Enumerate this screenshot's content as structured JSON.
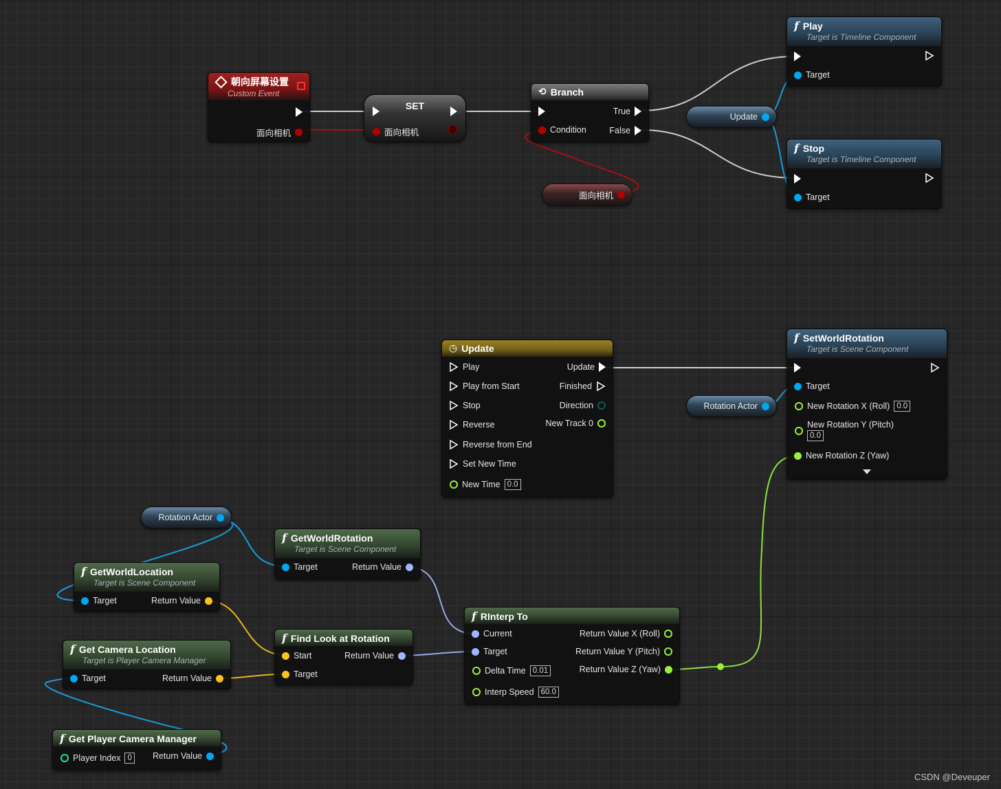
{
  "nodes": {
    "custom_event": {
      "title": "朝向屏幕设置",
      "subtitle": "Custom Event",
      "out_pin": "面向相机"
    },
    "set": {
      "title": "SET",
      "in_pin": "面向相机"
    },
    "branch": {
      "title": "Branch",
      "condition": "Condition",
      "true_label": "True",
      "false_label": "False"
    },
    "var_facing": {
      "label": "面向相机"
    },
    "var_update": {
      "label": "Update"
    },
    "play": {
      "title": "Play",
      "subtitle": "Target is Timeline Component",
      "target": "Target"
    },
    "stop": {
      "title": "Stop",
      "subtitle": "Target is Timeline Component",
      "target": "Target"
    },
    "timeline": {
      "title": "Update",
      "inputs": [
        "Play",
        "Play from Start",
        "Stop",
        "Reverse",
        "Reverse from End",
        "Set New Time"
      ],
      "new_time_label": "New Time",
      "new_time_value": "0.0",
      "outputs": [
        "Update",
        "Finished",
        "Direction",
        "New Track 0"
      ]
    },
    "set_world_rotation": {
      "title": "SetWorldRotation",
      "subtitle": "Target is Scene Component",
      "target": "Target",
      "roll_label": "New Rotation X (Roll)",
      "roll_value": "0.0",
      "pitch_label": "New Rotation Y (Pitch)",
      "pitch_value": "0.0",
      "yaw_label": "New Rotation Z (Yaw)"
    },
    "var_rotation_actor_1": {
      "label": "Rotation Actor"
    },
    "var_rotation_actor_2": {
      "label": "Rotation Actor"
    },
    "get_world_rotation": {
      "title": "GetWorldRotation",
      "subtitle": "Target is Scene Component",
      "target": "Target",
      "ret": "Return Value"
    },
    "get_world_location": {
      "title": "GetWorldLocation",
      "subtitle": "Target is Scene Component",
      "target": "Target",
      "ret": "Return Value"
    },
    "get_camera_location": {
      "title": "Get Camera Location",
      "subtitle": "Target is Player Camera Manager",
      "target": "Target",
      "ret": "Return Value"
    },
    "find_look_at": {
      "title": "Find Look at Rotation",
      "start": "Start",
      "target": "Target",
      "ret": "Return Value"
    },
    "rinterp": {
      "title": "RInterp To",
      "current": "Current",
      "target": "Target",
      "delta_label": "Delta Time",
      "delta_value": "0.01",
      "speed_label": "Interp Speed",
      "speed_value": "60.0",
      "ret_x": "Return Value X (Roll)",
      "ret_y": "Return Value Y (Pitch)",
      "ret_z": "Return Value Z (Yaw)"
    },
    "get_player_camera_manager": {
      "title": "Get Player Camera Manager",
      "player_index_label": "Player Index",
      "player_index_value": "0",
      "ret": "Return Value"
    }
  },
  "colors": {
    "exec": "#ffffff",
    "bool": "#b50000",
    "object": "#00a8f4",
    "vector": "#f9c31a",
    "rotator": "#a0b4ff",
    "float": "#9cf03c",
    "int": "#1fe0b0",
    "wire_exec": "#d8d8d8"
  },
  "watermark": "CSDN @Deveuper"
}
